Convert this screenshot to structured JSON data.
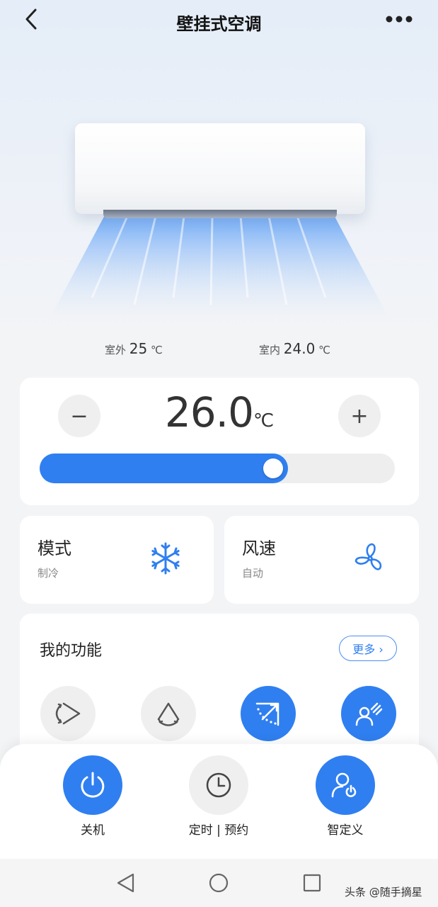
{
  "header": {
    "title": "壁挂式空调",
    "back_icon": "chevron-left-icon",
    "more_icon": "more-horizontal-icon"
  },
  "ambient": {
    "outdoor_label": "室外",
    "outdoor_value": "25",
    "outdoor_unit": "℃",
    "indoor_label": "室内",
    "indoor_value": "24.0",
    "indoor_unit": "℃"
  },
  "temperature": {
    "minus_label": "−",
    "plus_label": "+",
    "value": "26.0",
    "unit": "℃",
    "slider_fraction": 0.7
  },
  "mode": {
    "title": "模式",
    "value": "制冷",
    "icon": "snowflake-icon"
  },
  "wind": {
    "title": "风速",
    "value": "自动",
    "icon": "fan-icon"
  },
  "functions": {
    "title": "我的功能",
    "more_label": "更多 ›",
    "items": [
      {
        "icon": "swing-horizontal-icon",
        "active": false
      },
      {
        "icon": "swing-vertical-icon",
        "active": false
      },
      {
        "icon": "wind-deflect-icon",
        "active": true
      },
      {
        "icon": "wind-avoid-person-icon",
        "active": true
      }
    ]
  },
  "bottom": {
    "power_label": "关机",
    "timer_label": "定时 | 预约",
    "custom_label": "智定义"
  },
  "watermark": "头条 @随手摘星",
  "colors": {
    "accent": "#2f7ff0",
    "card_bg": "#ffffff",
    "page_bg": "#f3f4f6"
  }
}
